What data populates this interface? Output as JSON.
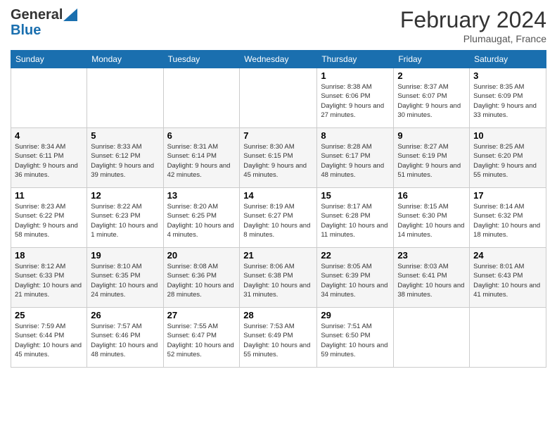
{
  "header": {
    "logo_line1": "General",
    "logo_line2": "Blue",
    "month": "February 2024",
    "location": "Plumaugat, France"
  },
  "days_of_week": [
    "Sunday",
    "Monday",
    "Tuesday",
    "Wednesday",
    "Thursday",
    "Friday",
    "Saturday"
  ],
  "weeks": [
    [
      {
        "num": "",
        "info": ""
      },
      {
        "num": "",
        "info": ""
      },
      {
        "num": "",
        "info": ""
      },
      {
        "num": "",
        "info": ""
      },
      {
        "num": "1",
        "info": "Sunrise: 8:38 AM\nSunset: 6:06 PM\nDaylight: 9 hours and 27 minutes."
      },
      {
        "num": "2",
        "info": "Sunrise: 8:37 AM\nSunset: 6:07 PM\nDaylight: 9 hours and 30 minutes."
      },
      {
        "num": "3",
        "info": "Sunrise: 8:35 AM\nSunset: 6:09 PM\nDaylight: 9 hours and 33 minutes."
      }
    ],
    [
      {
        "num": "4",
        "info": "Sunrise: 8:34 AM\nSunset: 6:11 PM\nDaylight: 9 hours and 36 minutes."
      },
      {
        "num": "5",
        "info": "Sunrise: 8:33 AM\nSunset: 6:12 PM\nDaylight: 9 hours and 39 minutes."
      },
      {
        "num": "6",
        "info": "Sunrise: 8:31 AM\nSunset: 6:14 PM\nDaylight: 9 hours and 42 minutes."
      },
      {
        "num": "7",
        "info": "Sunrise: 8:30 AM\nSunset: 6:15 PM\nDaylight: 9 hours and 45 minutes."
      },
      {
        "num": "8",
        "info": "Sunrise: 8:28 AM\nSunset: 6:17 PM\nDaylight: 9 hours and 48 minutes."
      },
      {
        "num": "9",
        "info": "Sunrise: 8:27 AM\nSunset: 6:19 PM\nDaylight: 9 hours and 51 minutes."
      },
      {
        "num": "10",
        "info": "Sunrise: 8:25 AM\nSunset: 6:20 PM\nDaylight: 9 hours and 55 minutes."
      }
    ],
    [
      {
        "num": "11",
        "info": "Sunrise: 8:23 AM\nSunset: 6:22 PM\nDaylight: 9 hours and 58 minutes."
      },
      {
        "num": "12",
        "info": "Sunrise: 8:22 AM\nSunset: 6:23 PM\nDaylight: 10 hours and 1 minute."
      },
      {
        "num": "13",
        "info": "Sunrise: 8:20 AM\nSunset: 6:25 PM\nDaylight: 10 hours and 4 minutes."
      },
      {
        "num": "14",
        "info": "Sunrise: 8:19 AM\nSunset: 6:27 PM\nDaylight: 10 hours and 8 minutes."
      },
      {
        "num": "15",
        "info": "Sunrise: 8:17 AM\nSunset: 6:28 PM\nDaylight: 10 hours and 11 minutes."
      },
      {
        "num": "16",
        "info": "Sunrise: 8:15 AM\nSunset: 6:30 PM\nDaylight: 10 hours and 14 minutes."
      },
      {
        "num": "17",
        "info": "Sunrise: 8:14 AM\nSunset: 6:32 PM\nDaylight: 10 hours and 18 minutes."
      }
    ],
    [
      {
        "num": "18",
        "info": "Sunrise: 8:12 AM\nSunset: 6:33 PM\nDaylight: 10 hours and 21 minutes."
      },
      {
        "num": "19",
        "info": "Sunrise: 8:10 AM\nSunset: 6:35 PM\nDaylight: 10 hours and 24 minutes."
      },
      {
        "num": "20",
        "info": "Sunrise: 8:08 AM\nSunset: 6:36 PM\nDaylight: 10 hours and 28 minutes."
      },
      {
        "num": "21",
        "info": "Sunrise: 8:06 AM\nSunset: 6:38 PM\nDaylight: 10 hours and 31 minutes."
      },
      {
        "num": "22",
        "info": "Sunrise: 8:05 AM\nSunset: 6:39 PM\nDaylight: 10 hours and 34 minutes."
      },
      {
        "num": "23",
        "info": "Sunrise: 8:03 AM\nSunset: 6:41 PM\nDaylight: 10 hours and 38 minutes."
      },
      {
        "num": "24",
        "info": "Sunrise: 8:01 AM\nSunset: 6:43 PM\nDaylight: 10 hours and 41 minutes."
      }
    ],
    [
      {
        "num": "25",
        "info": "Sunrise: 7:59 AM\nSunset: 6:44 PM\nDaylight: 10 hours and 45 minutes."
      },
      {
        "num": "26",
        "info": "Sunrise: 7:57 AM\nSunset: 6:46 PM\nDaylight: 10 hours and 48 minutes."
      },
      {
        "num": "27",
        "info": "Sunrise: 7:55 AM\nSunset: 6:47 PM\nDaylight: 10 hours and 52 minutes."
      },
      {
        "num": "28",
        "info": "Sunrise: 7:53 AM\nSunset: 6:49 PM\nDaylight: 10 hours and 55 minutes."
      },
      {
        "num": "29",
        "info": "Sunrise: 7:51 AM\nSunset: 6:50 PM\nDaylight: 10 hours and 59 minutes."
      },
      {
        "num": "",
        "info": ""
      },
      {
        "num": "",
        "info": ""
      }
    ]
  ]
}
